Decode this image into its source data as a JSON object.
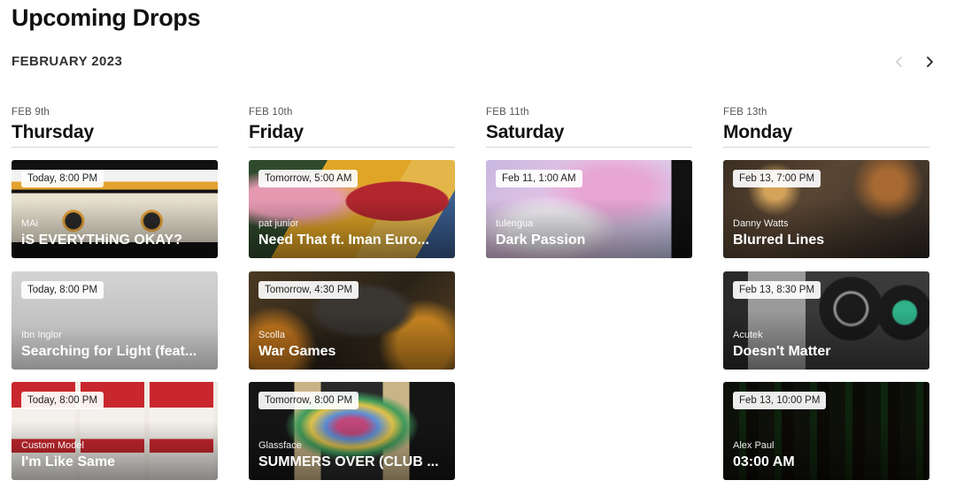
{
  "header": {
    "title": "Upcoming Drops",
    "month": "FEBRUARY 2023"
  },
  "nav": {
    "prev_icon": "chevron-left-icon",
    "next_icon": "chevron-right-icon"
  },
  "columns": [
    {
      "date": "FEB 9th",
      "day": "Thursday",
      "drops": [
        {
          "time": "Today, 8:00 PM",
          "artist": "MAi",
          "title": "iS EVERYTHiNG OKAY?"
        },
        {
          "time": "Today, 8:00 PM",
          "artist": "Ibn Inglor",
          "title": "Searching for Light (feat..."
        },
        {
          "time": "Today, 8:00 PM",
          "artist": "Custom Model",
          "title": "I'm Like Same"
        }
      ]
    },
    {
      "date": "FEB 10th",
      "day": "Friday",
      "drops": [
        {
          "time": "Tomorrow, 5:00 AM",
          "artist": "pat junior",
          "title": "Need That ft. Iman Euro..."
        },
        {
          "time": "Tomorrow, 4:30 PM",
          "artist": "Scolla",
          "title": "War Games"
        },
        {
          "time": "Tomorrow, 8:00 PM",
          "artist": "Glassface",
          "title": "SUMMERS OVER (CLUB ..."
        }
      ]
    },
    {
      "date": "FEB 11th",
      "day": "Saturday",
      "drops": [
        {
          "time": "Feb 11, 1:00 AM",
          "artist": "tulengua",
          "title": "Dark Passion"
        }
      ]
    },
    {
      "date": "FEB 13th",
      "day": "Monday",
      "drops": [
        {
          "time": "Feb 13, 7:00 PM",
          "artist": "Danny Watts",
          "title": "Blurred Lines"
        },
        {
          "time": "Feb 13, 8:30 PM",
          "artist": "Acutek",
          "title": "Doesn't Matter"
        },
        {
          "time": "Feb 13, 10:00 PM",
          "artist": "Alex Paul",
          "title": "03:00 AM"
        }
      ]
    }
  ]
}
